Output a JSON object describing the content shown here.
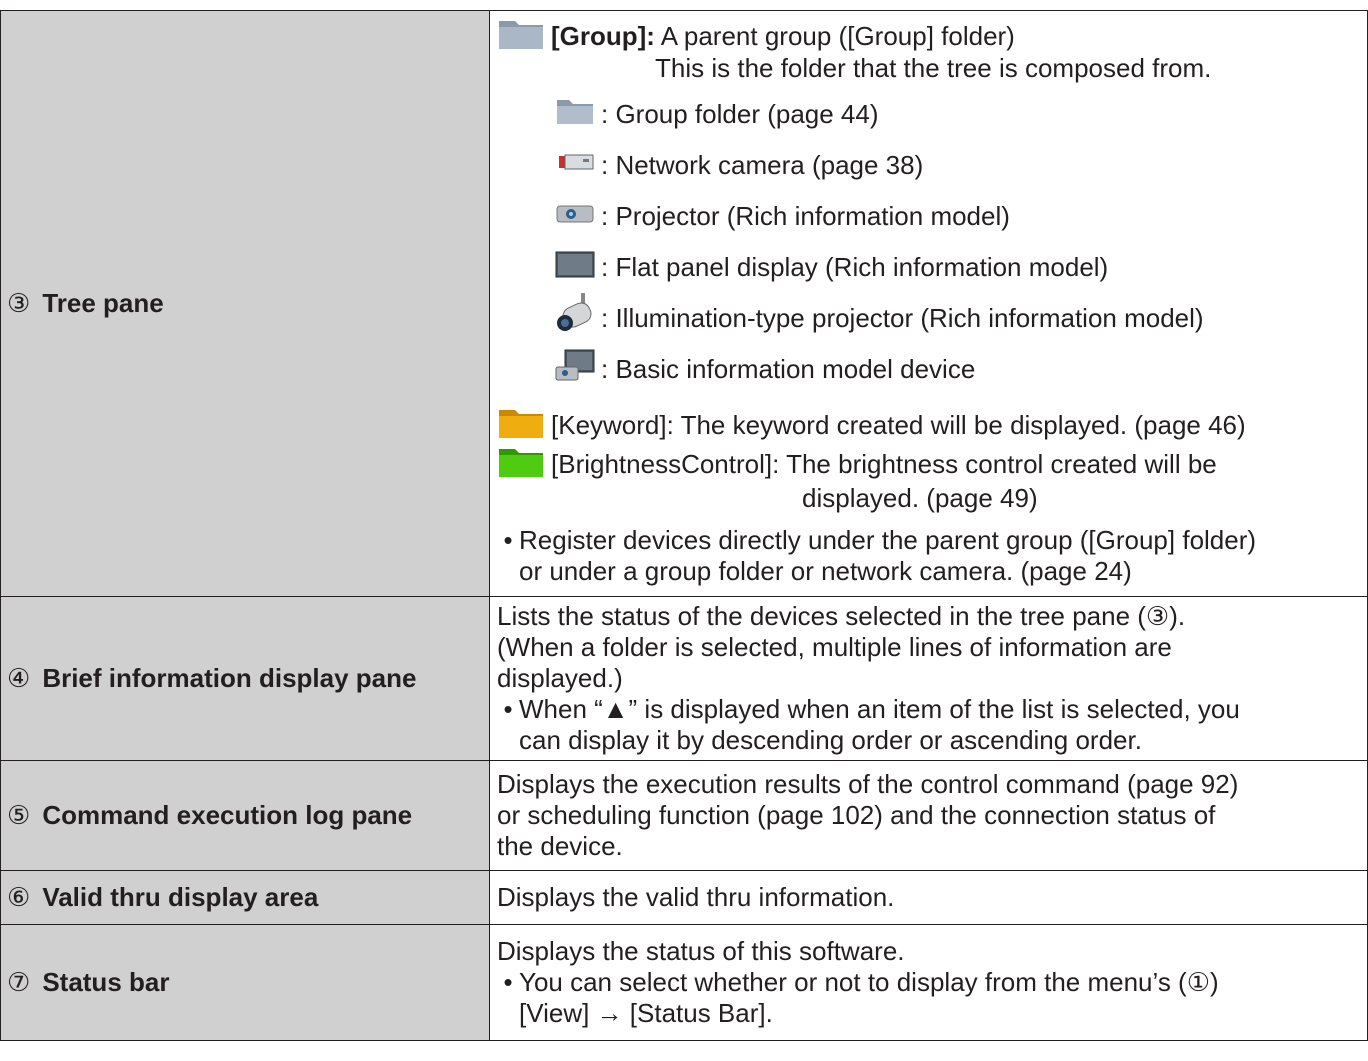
{
  "rows": [
    {
      "num": "③",
      "label": "Tree pane",
      "group_key": "[Group]:",
      "group_text": " A parent group ([Group] folder)",
      "group_cont": "This is the folder that the tree is composed from.",
      "items": [
        {
          "icon": "folder-icon",
          "text": ": Group folder (page 44)"
        },
        {
          "icon": "network-camera-icon",
          "text": ": Network camera  (page 38)"
        },
        {
          "icon": "projector-icon",
          "text": ": Projector (Rich information model)"
        },
        {
          "icon": "flat-panel-display-icon",
          "text": ": Flat panel display (Rich information model)"
        },
        {
          "icon": "illumination-projector-icon",
          "text": ": Illumination-type projector (Rich information model)"
        },
        {
          "icon": "basic-device-icon",
          "text": ": Basic information model device"
        }
      ],
      "keyword_text": "[Keyword]: The keyword created will be displayed. (page 46)",
      "brightness_text": "[BrightnessControl]: The brightness control created will be",
      "brightness_cont": "displayed. (page 49)",
      "bullet_dot": "•",
      "bullet_1": "Register devices directly under the parent group ([Group] folder)",
      "bullet_2": "or under a group folder or network camera. (page 24)"
    },
    {
      "num": "④",
      "label": "Brief information display pane",
      "lines": [
        "Lists the status of the devices selected in the tree pane (③).",
        "(When a folder is selected, multiple lines of information are",
        "displayed.)"
      ],
      "bullet_1": "When “▲” is displayed when an item of the list is selected, you",
      "bullet_2": "can display it by descending order or ascending order."
    },
    {
      "num": "⑤",
      "label": "Command execution log pane",
      "lines": [
        "Displays the execution results of the control command (page 92)",
        "or scheduling function (page 102) and the connection status of",
        "the device."
      ]
    },
    {
      "num": "⑥",
      "label": "Valid thru display area",
      "lines": [
        "Displays the valid thru information."
      ]
    },
    {
      "num": "⑦",
      "label": "Status bar",
      "lines": [
        "Displays the status of this software."
      ],
      "bullet_1": "You can select whether or not to display from the menu’s (①)",
      "bullet_2": "[View] → [Status Bar]."
    }
  ],
  "colors": {
    "label_bg": "#d0d0d0",
    "keyword_folder": "#e8a400",
    "brightness_folder": "#3cb400",
    "group_folder": "#8a9aab"
  }
}
